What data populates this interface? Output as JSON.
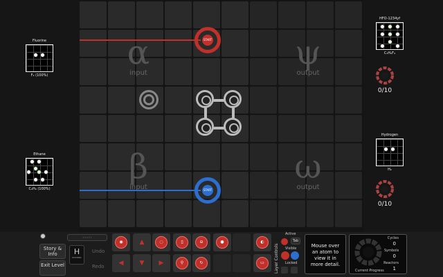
{
  "left_panel": {
    "target_1": {
      "title": "Fluorine",
      "formula": "F₂ (100%)"
    },
    "target_2": {
      "title": "Ethane",
      "formula": "C₂H₆ (100%)"
    }
  },
  "right_panel": {
    "output_1": {
      "title": "HFO-1234yf",
      "formula": "C₃H₂F₄",
      "count": "0/10"
    },
    "output_2": {
      "title": "Hydrogen",
      "formula": "H₂",
      "count": "0/10"
    }
  },
  "board": {
    "quadrants": {
      "alpha": {
        "symbol": "α",
        "sub": "input"
      },
      "psi": {
        "symbol": "ψ",
        "sub": "output"
      },
      "beta": {
        "symbol": "β",
        "sub": "input"
      },
      "omega": {
        "symbol": "ω",
        "sub": "output"
      }
    },
    "red_waldo_label": "START",
    "blue_waldo_label": "START"
  },
  "bottom": {
    "story_label": "Story & Info",
    "exit_label": "Exit Level",
    "mystery_label": "MYSTERY",
    "undo_label": "Undo",
    "redo_label": "Redo",
    "layer_title": "Layer Controls",
    "active_label": "Active",
    "tab_label": "Tab",
    "visible_label": "Visible",
    "locked_label": "Locked",
    "hint_text": "Mouse over an atom to view it in more detail.",
    "progress_label": "Current Progress",
    "cycles_label": "Cycles",
    "cycles_value": "0",
    "symbols_label": "Symbols",
    "symbols_value": "0",
    "reactors_label": "Reactors",
    "reactors_value": "1"
  },
  "colors": {
    "red": "#c0312b",
    "blue": "#2d6fd1",
    "board_cell": "#2a2a2a"
  }
}
